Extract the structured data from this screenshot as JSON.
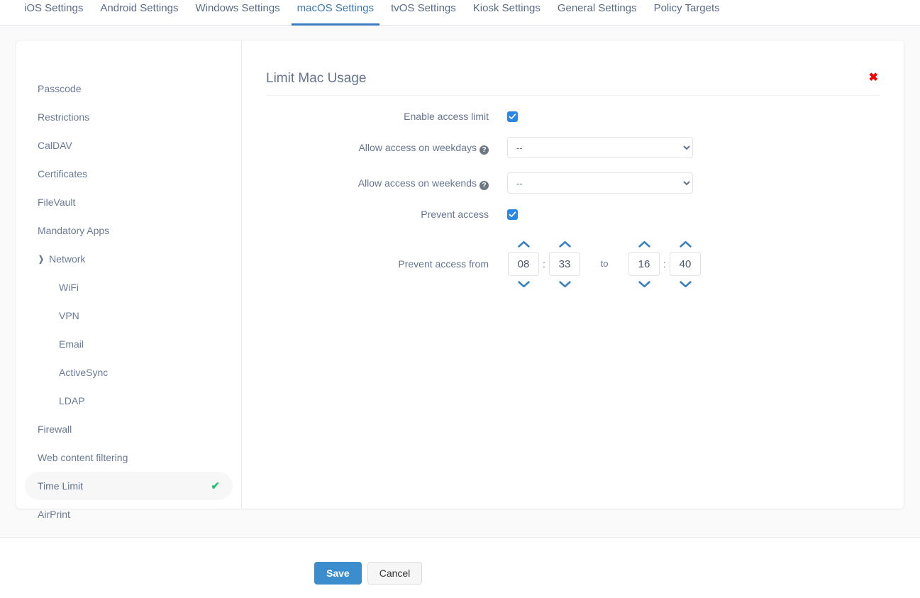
{
  "tabs": [
    {
      "label": "iOS Settings",
      "active": false
    },
    {
      "label": "Android Settings",
      "active": false
    },
    {
      "label": "Windows Settings",
      "active": false
    },
    {
      "label": "macOS Settings",
      "active": true
    },
    {
      "label": "tvOS Settings",
      "active": false
    },
    {
      "label": "Kiosk Settings",
      "active": false
    },
    {
      "label": "General Settings",
      "active": false
    },
    {
      "label": "Policy Targets",
      "active": false
    }
  ],
  "sidebar": {
    "items": [
      {
        "label": "Passcode",
        "indent": false,
        "expander": false,
        "active": false,
        "configured": false
      },
      {
        "label": "Restrictions",
        "indent": false,
        "expander": false,
        "active": false,
        "configured": false
      },
      {
        "label": "CalDAV",
        "indent": false,
        "expander": false,
        "active": false,
        "configured": false
      },
      {
        "label": "Certificates",
        "indent": false,
        "expander": false,
        "active": false,
        "configured": false
      },
      {
        "label": "FileVault",
        "indent": false,
        "expander": false,
        "active": false,
        "configured": false
      },
      {
        "label": "Mandatory Apps",
        "indent": false,
        "expander": false,
        "active": false,
        "configured": false
      },
      {
        "label": "Network",
        "indent": false,
        "expander": true,
        "active": false,
        "configured": false
      },
      {
        "label": "WiFi",
        "indent": true,
        "expander": false,
        "active": false,
        "configured": false
      },
      {
        "label": "VPN",
        "indent": true,
        "expander": false,
        "active": false,
        "configured": false
      },
      {
        "label": "Email",
        "indent": true,
        "expander": false,
        "active": false,
        "configured": false
      },
      {
        "label": "ActiveSync",
        "indent": true,
        "expander": false,
        "active": false,
        "configured": false
      },
      {
        "label": "LDAP",
        "indent": true,
        "expander": false,
        "active": false,
        "configured": false
      },
      {
        "label": "Firewall",
        "indent": false,
        "expander": false,
        "active": false,
        "configured": false
      },
      {
        "label": "Web content filtering",
        "indent": false,
        "expander": false,
        "active": false,
        "configured": false
      },
      {
        "label": "Time Limit",
        "indent": false,
        "expander": false,
        "active": true,
        "configured": true
      },
      {
        "label": "AirPrint",
        "indent": false,
        "expander": false,
        "active": false,
        "configured": false
      }
    ],
    "expander_glyph": "❯",
    "configured_glyph": "✔"
  },
  "panel": {
    "title": "Limit Mac Usage",
    "close_glyph": "✖"
  },
  "form": {
    "enable_access_limit": {
      "label": "Enable access limit",
      "checked": true,
      "check_glyph": "✓"
    },
    "weekdays": {
      "label": "Allow access on weekdays",
      "help": "?",
      "value": "--",
      "options": [
        "--"
      ]
    },
    "weekends": {
      "label": "Allow access on weekends",
      "help": "?",
      "value": "--",
      "options": [
        "--"
      ]
    },
    "prevent_access": {
      "label": "Prevent access",
      "checked": true,
      "check_glyph": "✓"
    },
    "prevent_access_from": {
      "label": "Prevent access from",
      "to_label": "to",
      "colon": ":",
      "from_hour": "08",
      "from_minute": "33",
      "to_hour": "16",
      "to_minute": "40"
    }
  },
  "footer": {
    "save_label": "Save",
    "cancel_label": "Cancel"
  },
  "colors": {
    "accent": "#3b7cbf",
    "checkbox": "#2b87e3",
    "close": "#f30000",
    "configured_check": "#25c16f",
    "spinner_arrow": "#3680c2",
    "save_button": "#3c8dcd"
  }
}
